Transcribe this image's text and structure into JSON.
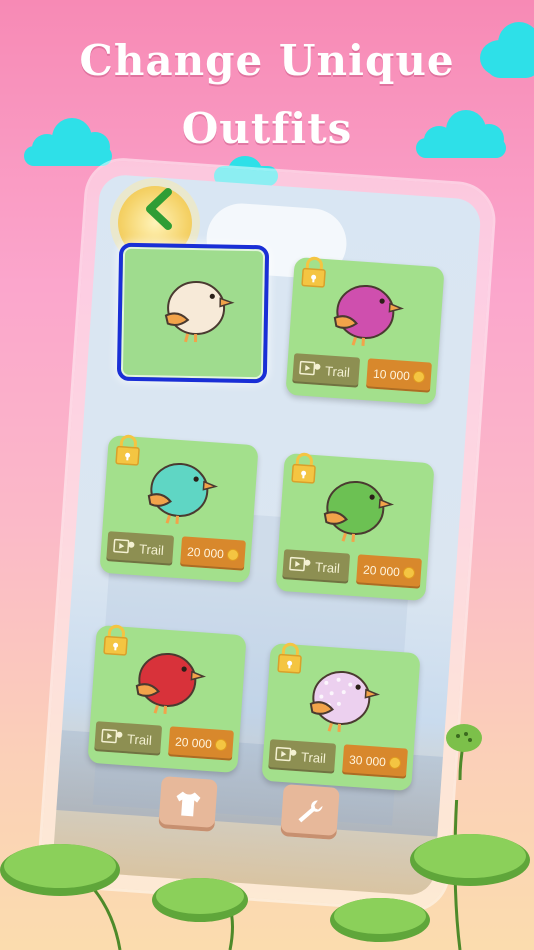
{
  "headline": {
    "line1": "Change Unique",
    "line2": "Outfits"
  },
  "nav": {
    "back_icon": "chevron-left-icon"
  },
  "outfits": [
    {
      "name": "cream",
      "body": "#f7ead8",
      "belly": "#f0dcc0",
      "locked": false,
      "selected": true
    },
    {
      "name": "magenta",
      "body": "#cf4fae",
      "belly": "#b73b97",
      "locked": true,
      "trail_label": "Trail",
      "price": "10 000"
    },
    {
      "name": "teal",
      "body": "#5fd6c4",
      "belly": "#48bfae",
      "locked": true,
      "trail_label": "Trail",
      "price": "20 000"
    },
    {
      "name": "green",
      "body": "#6cc153",
      "belly": "#57a843",
      "locked": true,
      "trail_label": "Trail",
      "price": "20 000"
    },
    {
      "name": "red",
      "body": "#d8323a",
      "belly": "#bb2530",
      "locked": true,
      "trail_label": "Trail",
      "price": "20 000"
    },
    {
      "name": "polka",
      "body": "#ecd0ef",
      "belly": "#d8b3dc",
      "locked": true,
      "trail_label": "Trail",
      "price": "30 000"
    }
  ],
  "bottom_buttons": [
    {
      "icon": "shirt-icon"
    },
    {
      "icon": "wrench-icon"
    }
  ],
  "colors": {
    "card": "#a3e08c",
    "selected_border": "#1a2fd6",
    "trail_button": "#8d8f52",
    "price_button": "#d8882c",
    "cloud": "#2ee0e8"
  }
}
